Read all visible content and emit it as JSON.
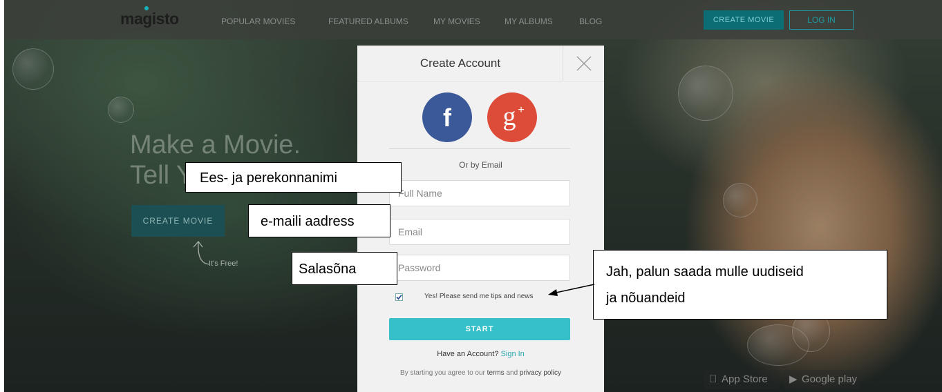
{
  "nav": {
    "logo": "magisto",
    "items": [
      "POPULAR MOVIES",
      "FEATURED ALBUMS",
      "MY MOVIES",
      "MY ALBUMS",
      "BLOG"
    ],
    "create_movie": "CREATE MOVIE",
    "login": "LOG IN"
  },
  "hero": {
    "line1": "Make a Movie.",
    "line2": "Tell Y",
    "button": "CREATE MOVIE",
    "free_note": "It's Free!"
  },
  "badges": {
    "app_store": "App Store",
    "google_play": "Google play"
  },
  "modal": {
    "title": "Create Account",
    "or_email": "Or by Email",
    "full_name_placeholder": "Full Name",
    "email_placeholder": "Email",
    "password_placeholder": "Password",
    "newsletter_label": "Yes! Please send me tips and news",
    "newsletter_checked": true,
    "start": "START",
    "have_account": "Have an Account?",
    "sign_in": "Sign In",
    "terms_prefix": "By starting you agree to our",
    "terms": "terms",
    "and": "and",
    "privacy": "privacy policy"
  },
  "callouts": {
    "name": "Ees- ja perekonnanimi",
    "email": "e-maili aadress",
    "password": "Salasõna",
    "newsletter_line1": "Jah, palun saada mulle uudiseid",
    "newsletter_line2": "ja nõuandeid"
  },
  "colors": {
    "accent": "#35c0ca",
    "facebook": "#3b5998",
    "google": "#dd4b39",
    "create_btn": "#0d6d74"
  }
}
